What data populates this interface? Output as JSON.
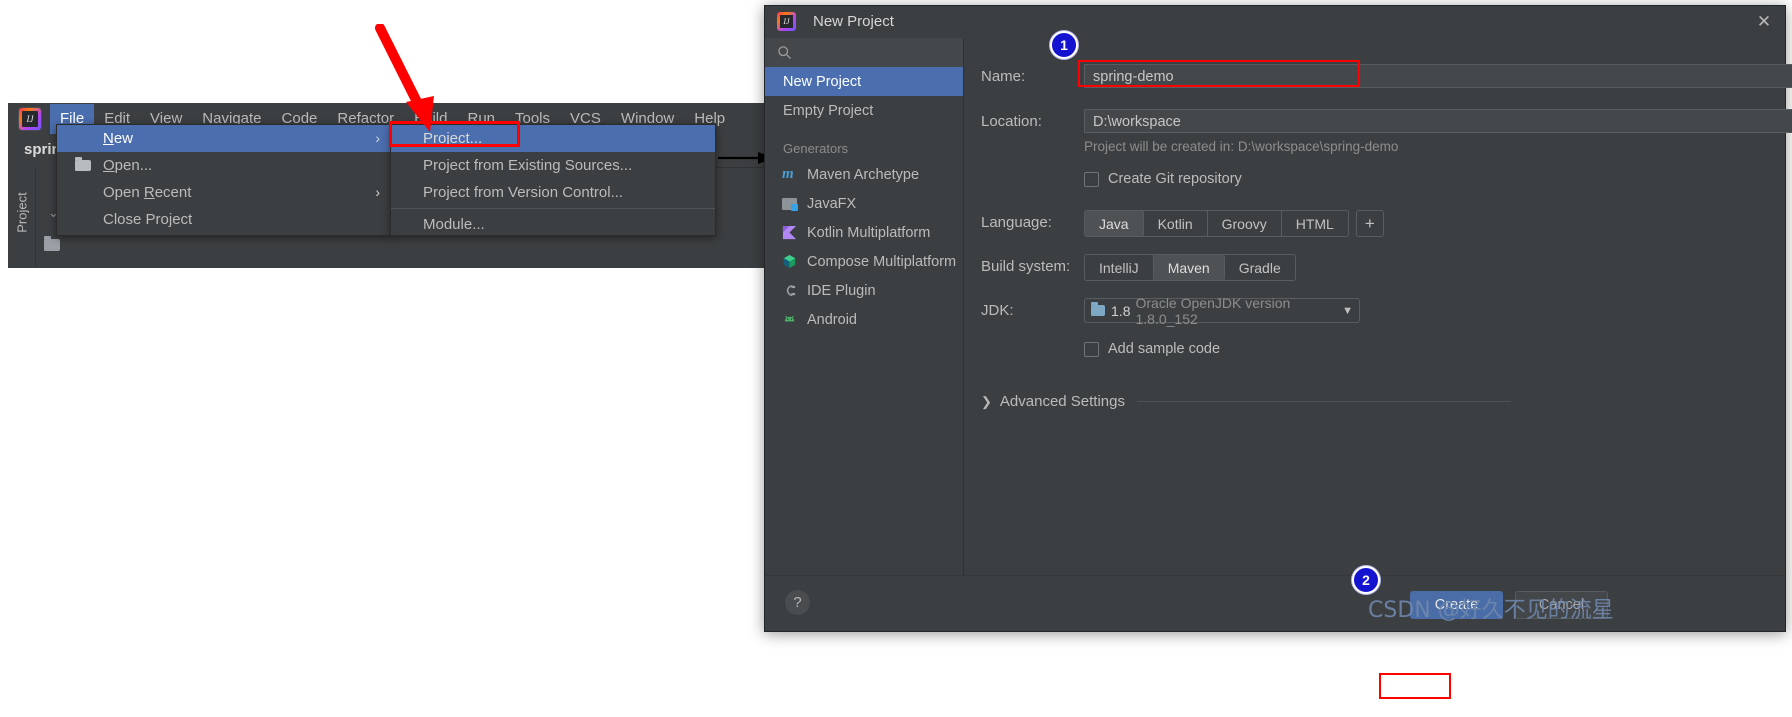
{
  "ide": {
    "logo_icon": "intellij-logo-icon",
    "menubar": [
      {
        "label": "File",
        "mnemonic": "F",
        "active": true
      },
      {
        "label": "Edit",
        "mnemonic": "E",
        "active": false
      },
      {
        "label": "View",
        "mnemonic": "V",
        "active": false
      },
      {
        "label": "Navigate",
        "mnemonic": "N",
        "active": false
      },
      {
        "label": "Code",
        "mnemonic": "C",
        "active": false
      },
      {
        "label": "Refactor",
        "mnemonic": "R",
        "active": false
      },
      {
        "label": "Build",
        "mnemonic": "B",
        "active": false
      },
      {
        "label": "Run",
        "mnemonic": "u",
        "active": false
      },
      {
        "label": "Tools",
        "mnemonic": "T",
        "active": false
      },
      {
        "label": "VCS",
        "mnemonic": "S",
        "active": false
      },
      {
        "label": "Window",
        "mnemonic": "W",
        "active": false
      },
      {
        "label": "Help",
        "mnemonic": "H",
        "active": false
      }
    ],
    "project_tab": "spring",
    "tool_window": "Project",
    "file_menu": [
      {
        "label": "New",
        "selected": true,
        "submenu": true,
        "icon": "none"
      },
      {
        "label": "Open...",
        "selected": false,
        "submenu": false,
        "icon": "folder-icon"
      },
      {
        "label": "Open Recent",
        "selected": false,
        "submenu": true,
        "icon": "none"
      },
      {
        "label": "Close Project",
        "selected": false,
        "submenu": false,
        "icon": "none"
      }
    ],
    "new_submenu": [
      {
        "label": "Project...",
        "selected": true
      },
      {
        "label": "Project from Existing Sources...",
        "selected": false
      },
      {
        "label": "Project from Version Control...",
        "selected": false
      },
      {
        "label": "Module...",
        "selected": false
      }
    ]
  },
  "dialog": {
    "title": "New Project",
    "title_icon": "intellij-logo-icon",
    "close_icon": "close-icon",
    "search_icon": "search-icon",
    "search_placeholder": "",
    "templates": [
      {
        "label": "New Project",
        "selected": true
      },
      {
        "label": "Empty Project",
        "selected": false
      }
    ],
    "generators_header": "Generators",
    "generators": [
      {
        "label": "Maven Archetype",
        "icon": "maven-icon"
      },
      {
        "label": "JavaFX",
        "icon": "javafx-icon"
      },
      {
        "label": "Kotlin Multiplatform",
        "icon": "kotlin-icon"
      },
      {
        "label": "Compose Multiplatform",
        "icon": "compose-icon"
      },
      {
        "label": "IDE Plugin",
        "icon": "plugin-icon"
      },
      {
        "label": "Android",
        "icon": "android-icon"
      }
    ],
    "form": {
      "name_label": "Name:",
      "name_value": "spring-demo",
      "location_label": "Location:",
      "location_value": "D:\\workspace",
      "location_browse_icon": "folder-browse-icon",
      "location_hint": "Project will be created in: D:\\workspace\\spring-demo",
      "git_checkbox_label": "Create Git repository",
      "git_checkbox_checked": false,
      "language_label": "Language:",
      "language_options": [
        "Java",
        "Kotlin",
        "Groovy",
        "HTML"
      ],
      "language_selected": "Java",
      "language_add_label": "+",
      "build_label": "Build system:",
      "build_options": [
        "IntelliJ",
        "Maven",
        "Gradle"
      ],
      "build_selected": "Maven",
      "jdk_label": "JDK:",
      "jdk_version": "1.8",
      "jdk_name": "Oracle OpenJDK version 1.8.0_152",
      "jdk_caret_icon": "chevron-down-icon",
      "sample_checkbox_label": "Add sample code",
      "sample_checkbox_checked": false,
      "advanced_label": "Advanced Settings",
      "advanced_chevron_icon": "chevron-right-icon"
    },
    "footer": {
      "help_label": "?",
      "create_label": "Create",
      "cancel_label": "Cancel"
    }
  },
  "annotations": {
    "badge_1": "1",
    "badge_2": "2",
    "watermark": "CSDN @好久不见的流星",
    "accent_red": "#ff0000",
    "accent_blue": "#1414d0",
    "selection_blue": "#4b6eaf"
  }
}
